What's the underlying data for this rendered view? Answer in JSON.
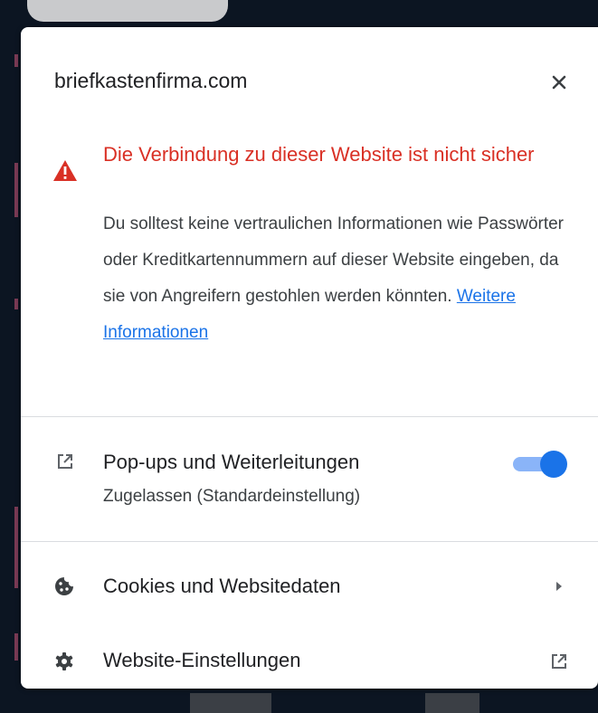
{
  "site": {
    "domain": "briefkastenfirma.com"
  },
  "close_label": "✕",
  "security": {
    "title": "Die Verbindung zu dieser Website ist nicht sicher",
    "body": "Du solltest keine vertraulichen Informationen wie Passwörter oder Kreditkartennummern auf dieser Website eingeben, da sie von Angreifern gestohlen werden könnten.",
    "link_text": "Weitere Informationen",
    "color": "#d93025",
    "icon": "warning-triangle-icon"
  },
  "popups": {
    "title": "Pop-ups und Weiterleitungen",
    "status": "Zugelassen (Standardeinstellung)",
    "icon": "open-in-new-icon",
    "enabled": true,
    "toggle_color": "#1a73e8"
  },
  "cookies": {
    "label": "Cookies und Websitedaten",
    "icon": "cookie-icon",
    "trailing_icon": "arrow-right-icon"
  },
  "site_settings": {
    "label": "Website-Einstellungen",
    "icon": "gear-icon",
    "trailing_icon": "open-in-new-icon"
  }
}
